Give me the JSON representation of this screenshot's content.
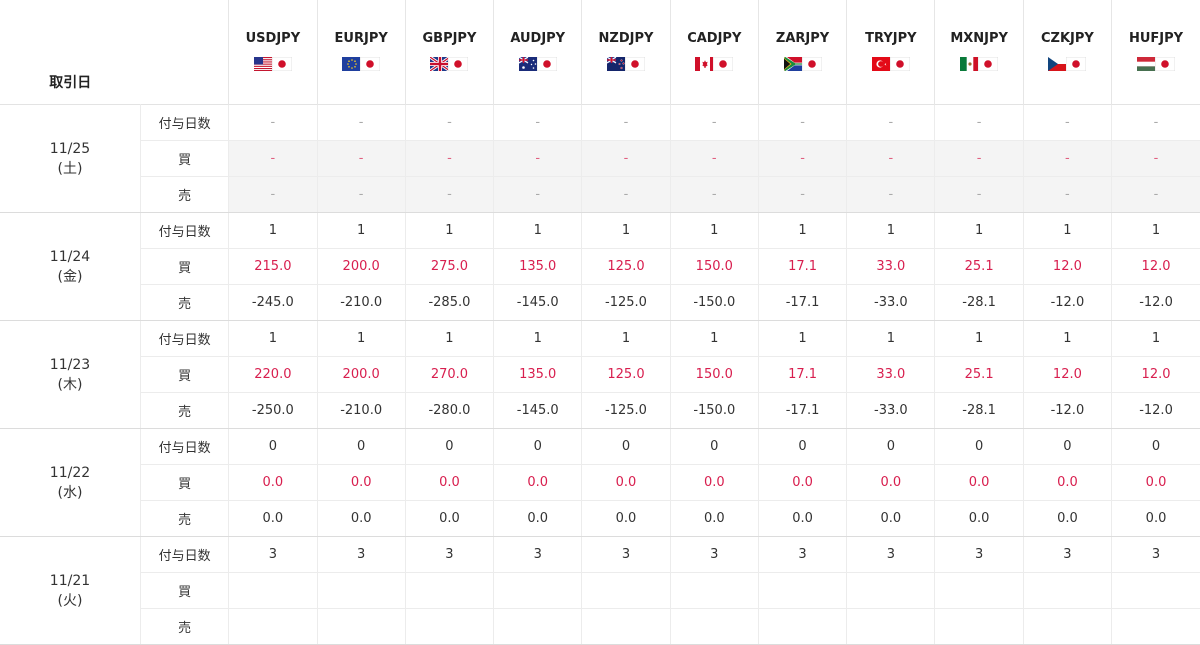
{
  "header": {
    "date_label": "取引日"
  },
  "pairs": [
    {
      "name": "USDJPY",
      "flag": "us"
    },
    {
      "name": "EURJPY",
      "flag": "eu"
    },
    {
      "name": "GBPJPY",
      "flag": "gb"
    },
    {
      "name": "AUDJPY",
      "flag": "au"
    },
    {
      "name": "NZDJPY",
      "flag": "nz"
    },
    {
      "name": "CADJPY",
      "flag": "ca"
    },
    {
      "name": "ZARJPY",
      "flag": "za"
    },
    {
      "name": "TRYJPY",
      "flag": "tr"
    },
    {
      "name": "MXNJPY",
      "flag": "mx"
    },
    {
      "name": "CZKJPY",
      "flag": "cz"
    },
    {
      "name": "HUFJPY",
      "flag": "hu"
    }
  ],
  "row_labels": {
    "days": "付与日数",
    "buy": "買",
    "sell": "売"
  },
  "colors": {
    "buy": "#d81e4e",
    "text": "#333333",
    "closed_bg": "#f4f4f4"
  },
  "groups": [
    {
      "date": "11/25",
      "weekday": "(土)",
      "closed": true,
      "days": [
        "-",
        "-",
        "-",
        "-",
        "-",
        "-",
        "-",
        "-",
        "-",
        "-",
        "-"
      ],
      "buy": [
        "-",
        "-",
        "-",
        "-",
        "-",
        "-",
        "-",
        "-",
        "-",
        "-",
        "-"
      ],
      "sell": [
        "-",
        "-",
        "-",
        "-",
        "-",
        "-",
        "-",
        "-",
        "-",
        "-",
        "-"
      ]
    },
    {
      "date": "11/24",
      "weekday": "(金)",
      "closed": false,
      "days": [
        "1",
        "1",
        "1",
        "1",
        "1",
        "1",
        "1",
        "1",
        "1",
        "1",
        "1"
      ],
      "buy": [
        "215.0",
        "200.0",
        "275.0",
        "135.0",
        "125.0",
        "150.0",
        "17.1",
        "33.0",
        "25.1",
        "12.0",
        "12.0"
      ],
      "sell": [
        "-245.0",
        "-210.0",
        "-285.0",
        "-145.0",
        "-125.0",
        "-150.0",
        "-17.1",
        "-33.0",
        "-28.1",
        "-12.0",
        "-12.0"
      ]
    },
    {
      "date": "11/23",
      "weekday": "(木)",
      "closed": false,
      "days": [
        "1",
        "1",
        "1",
        "1",
        "1",
        "1",
        "1",
        "1",
        "1",
        "1",
        "1"
      ],
      "buy": [
        "220.0",
        "200.0",
        "270.0",
        "135.0",
        "125.0",
        "150.0",
        "17.1",
        "33.0",
        "25.1",
        "12.0",
        "12.0"
      ],
      "sell": [
        "-250.0",
        "-210.0",
        "-280.0",
        "-145.0",
        "-125.0",
        "-150.0",
        "-17.1",
        "-33.0",
        "-28.1",
        "-12.0",
        "-12.0"
      ]
    },
    {
      "date": "11/22",
      "weekday": "(水)",
      "closed": false,
      "days": [
        "0",
        "0",
        "0",
        "0",
        "0",
        "0",
        "0",
        "0",
        "0",
        "0",
        "0"
      ],
      "buy": [
        "0.0",
        "0.0",
        "0.0",
        "0.0",
        "0.0",
        "0.0",
        "0.0",
        "0.0",
        "0.0",
        "0.0",
        "0.0"
      ],
      "sell": [
        "0.0",
        "0.0",
        "0.0",
        "0.0",
        "0.0",
        "0.0",
        "0.0",
        "0.0",
        "0.0",
        "0.0",
        "0.0"
      ]
    },
    {
      "date": "11/21",
      "weekday": "(火)",
      "closed": false,
      "days": [
        "3",
        "3",
        "3",
        "3",
        "3",
        "3",
        "3",
        "3",
        "3",
        "3",
        "3"
      ],
      "buy": [],
      "sell": []
    }
  ]
}
